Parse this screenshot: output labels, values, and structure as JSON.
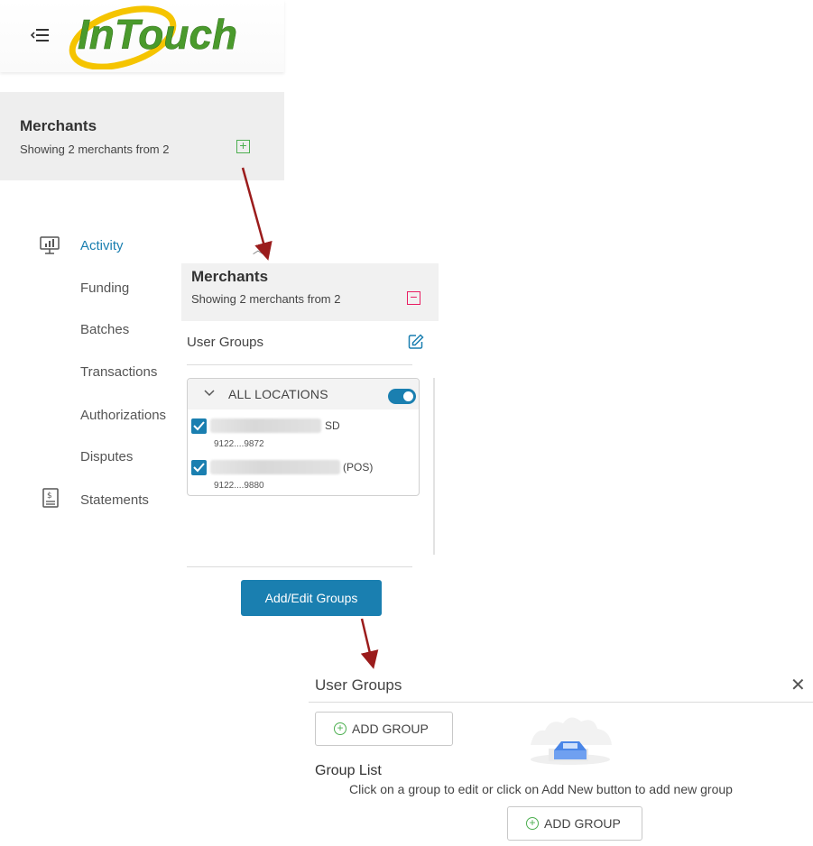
{
  "app": {
    "logo_text": "InTouch"
  },
  "sidebar": {
    "merchants": {
      "title": "Merchants",
      "subtitle": "Showing 2 merchants from 2"
    },
    "nav": [
      {
        "label": "Activity",
        "active": true
      },
      {
        "label": "Funding"
      },
      {
        "label": "Batches"
      },
      {
        "label": "Transactions"
      },
      {
        "label": "Authorizations"
      },
      {
        "label": "Disputes"
      },
      {
        "label": "Statements"
      }
    ]
  },
  "merchant_panel": {
    "title": "Merchants",
    "subtitle": "Showing 2 merchants from 2",
    "user_groups_label": "User Groups",
    "location_group": {
      "title": "ALL LOCATIONS",
      "toggle_on": true,
      "locations": [
        {
          "name_suffix": "SD",
          "id": "9122....9872",
          "checked": true
        },
        {
          "name_suffix": "(POS)",
          "id": "9122....9880",
          "checked": true
        }
      ]
    },
    "add_edit_button": "Add/Edit Groups"
  },
  "user_groups_modal": {
    "title": "User Groups",
    "add_group_button": "ADD GROUP",
    "group_list_title": "Group List",
    "group_list_description": "Click on a group to edit or click on Add New button to add new group",
    "add_group_button_bottom": "ADD GROUP"
  },
  "colors": {
    "accent": "#1a7fb0",
    "add": "#4caf50",
    "remove": "#e91e63",
    "annotation_arrow": "#9b1c1c"
  }
}
